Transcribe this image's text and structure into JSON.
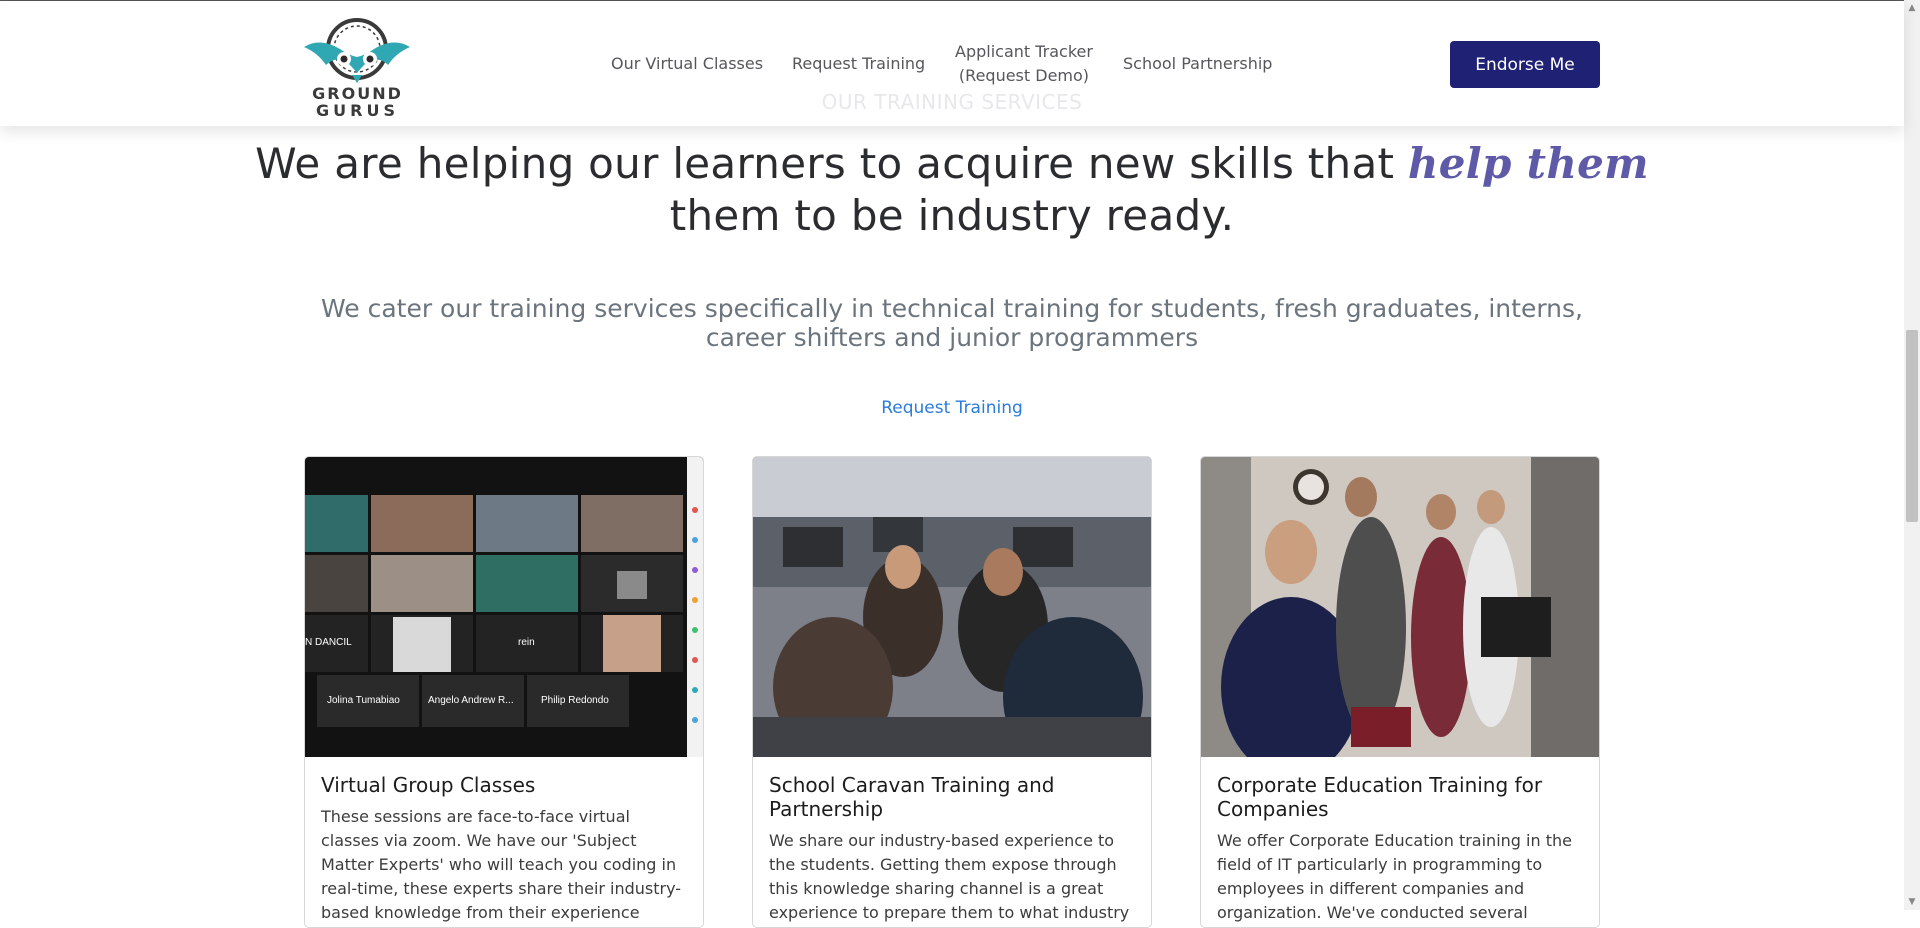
{
  "brand": {
    "line1": "GROUND",
    "line2": "GURUS"
  },
  "nav": {
    "items": [
      {
        "label": "Our Virtual Classes"
      },
      {
        "label": "Request Training"
      },
      {
        "label_line1": "Applicant Tracker",
        "label_line2": "(Request Demo)"
      },
      {
        "label": "School Partnership"
      }
    ],
    "cta": "Endorse Me"
  },
  "section": {
    "eyebrow": "OUR TRAINING SERVICES",
    "headline_part1": "We are helping our learners to acquire new skills that ",
    "headline_accent": "help them",
    "headline_part2": "them to be industry ready.",
    "subtext": "We cater our training services specifically in technical training for students, fresh graduates, interns, career shifters and junior programmers",
    "request_link": "Request Training"
  },
  "cards": [
    {
      "title": "Virtual Group Classes",
      "text": "These sessions are face-to-face virtual classes via zoom. We have our 'Subject Matter Experts' who will teach you coding in real-time, these experts share their industry-based knowledge from their experience working in the current",
      "zoom_labels": [
        "N DANCIL",
        "rein",
        "Jolina  Tumabiao",
        "Angelo Andrew R...",
        "Philip Redondo"
      ]
    },
    {
      "title": "School Caravan Training and Partnership",
      "text": "We share our industry-based experience to the students. Getting them expose through this knowledge sharing channel is a great experience to prepare them to what industry"
    },
    {
      "title": "Corporate Education Training for Companies",
      "text": "We offer Corporate Education training in the field of IT particularly in programming to employees in different companies and organization. We've conducted several trainings"
    }
  ],
  "colors": {
    "cta_bg": "#1f2175",
    "accent_text": "#5e5aa8",
    "link": "#2a7bdc",
    "logo_teal": "#2fa8b3"
  }
}
